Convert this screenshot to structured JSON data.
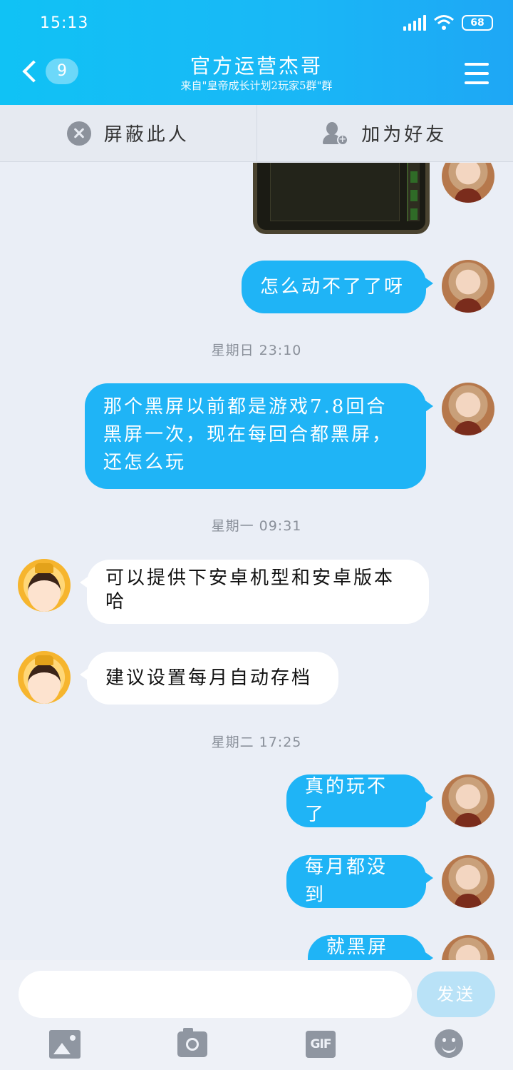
{
  "status_bar": {
    "time": "15:13",
    "battery": "68"
  },
  "header": {
    "back_count": "9",
    "title": "官方运营杰哥",
    "subtitle": "来自\"皇帝成长计划2玩家5群\"群"
  },
  "actions": {
    "block_label": "屏蔽此人",
    "add_friend_label": "加为好友"
  },
  "messages": {
    "m1": "怎么动不了了呀",
    "ts1": "星期日 23:10",
    "m2": "那个黑屏以前都是游戏7.8回合\n黑屏一次，现在每回合都黑屏，\n还怎么玩",
    "ts2": "星期一 09:31",
    "m3": "可以提供下安卓机型和安卓版本\n哈",
    "m4": "建议设置每月自动存档",
    "ts3": "星期二 17:25",
    "m5": "真的玩不了",
    "m6": "每月都没到",
    "m7": "就黑屏了"
  },
  "input": {
    "placeholder": "",
    "send_label": "发送"
  },
  "toolbar": {
    "gif_label": "GIF"
  },
  "icons": [
    "back-icon",
    "menu-icon",
    "block-icon",
    "add-friend-icon",
    "photo-icon",
    "camera-icon",
    "gif-icon",
    "emoji-icon"
  ],
  "colors": {
    "header": "#19b8f6",
    "my_bubble": "#1fb4f6",
    "other_bubble": "#ffffff",
    "background": "#eaeef6"
  }
}
